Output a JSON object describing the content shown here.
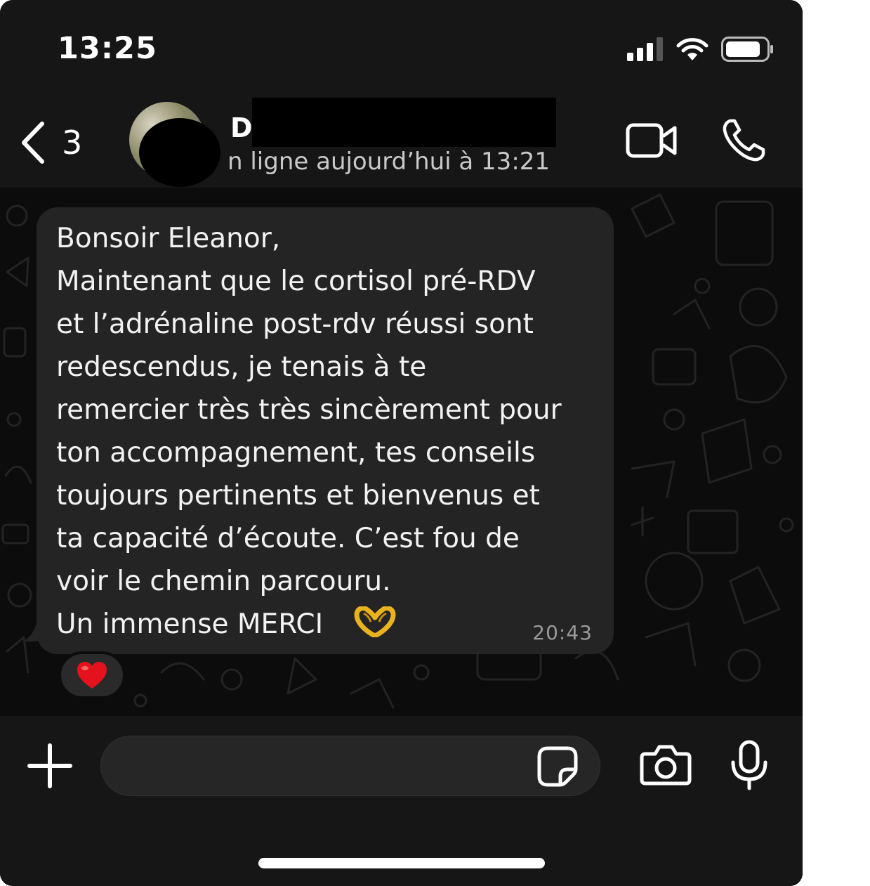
{
  "status_bar": {
    "time": "13:25",
    "icons": [
      "signal-icon",
      "wifi-icon",
      "battery-icon"
    ]
  },
  "header": {
    "back_count": "3",
    "contact_initial": "D",
    "last_seen": "n ligne aujourd’hui à 13:21",
    "icons": [
      "chevron-left-icon",
      "video-call-icon",
      "phone-icon"
    ]
  },
  "message": {
    "text": "Bonsoir Eleanor,\nMaintenant que le cortisol pré-RDV\net l’adrénaline post-rdv réussi sont\nredescendus, je tenais à te\nremercier très très sincèrement pour\nton accompagnement, tes conseils\ntoujours pertinents et bienvenus et\nta capacité d’écoute. C’est fou de\nvoir le chemin parcouru.\nUn immense MERCI",
    "emoji": "heart-hands-emoji",
    "time": "20:43",
    "reaction": "red-heart-emoji"
  },
  "input": {
    "value": "",
    "icons": [
      "plus-icon",
      "sticker-icon",
      "camera-icon",
      "microphone-icon"
    ]
  },
  "colors": {
    "background": "#0b0b0b",
    "bar": "#161616",
    "bubble": "#242424",
    "text": "#f2f2f2",
    "muted": "#9a9a9a"
  }
}
